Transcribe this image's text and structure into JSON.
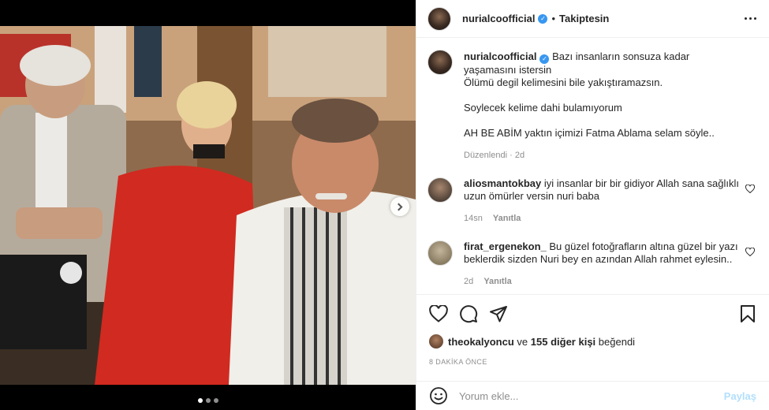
{
  "post": {
    "username": "nurialcoofficial",
    "follow_status": "Takiptesin",
    "bullet": "•"
  },
  "media": {
    "slide_count": 3,
    "active_slide": 1,
    "next_icon": "chevron-right-icon"
  },
  "caption": {
    "username": "nurialcoofficial",
    "line1": "Bazı insanların sonsuza kadar yaşamasını istersin",
    "line2": "Ölümü degil kelimesini bile yakıştıramazsın.",
    "line3": "Soylecek kelime dahi bulamıyorum",
    "line4": "AH BE ABİM yaktın içimizi Fatma Ablama selam söyle..",
    "edited": "Düzenlendi",
    "sep": "·",
    "time": "2d"
  },
  "comments": [
    {
      "username": "aliosmantokbay",
      "text": "iyi insanlar bir bir gidiyor Allah sana sağlıklı uzun ömürler versin nuri baba",
      "time": "14sn",
      "reply": "Yanıtla"
    },
    {
      "username": "firat_ergenekon_",
      "text": "Bu güzel fotoğrafların altına güzel bir yazı beklerdik sizden Nuri bey en azından Allah rahmet eylesin..",
      "time": "2d",
      "reply": "Yanıtla"
    }
  ],
  "likes": {
    "first_user": "theokalyoncu",
    "connector": "ve",
    "others": "155 diğer kişi",
    "suffix": "beğendi"
  },
  "timeago": "8 DAKİKA ÖNCE",
  "add_comment": {
    "placeholder": "Yorum ekle...",
    "post_label": "Paylaş"
  },
  "colors": {
    "verified": "#3897f0",
    "post_disabled": "#b2dffc",
    "muted": "#8e8e8e",
    "text": "#262626"
  }
}
